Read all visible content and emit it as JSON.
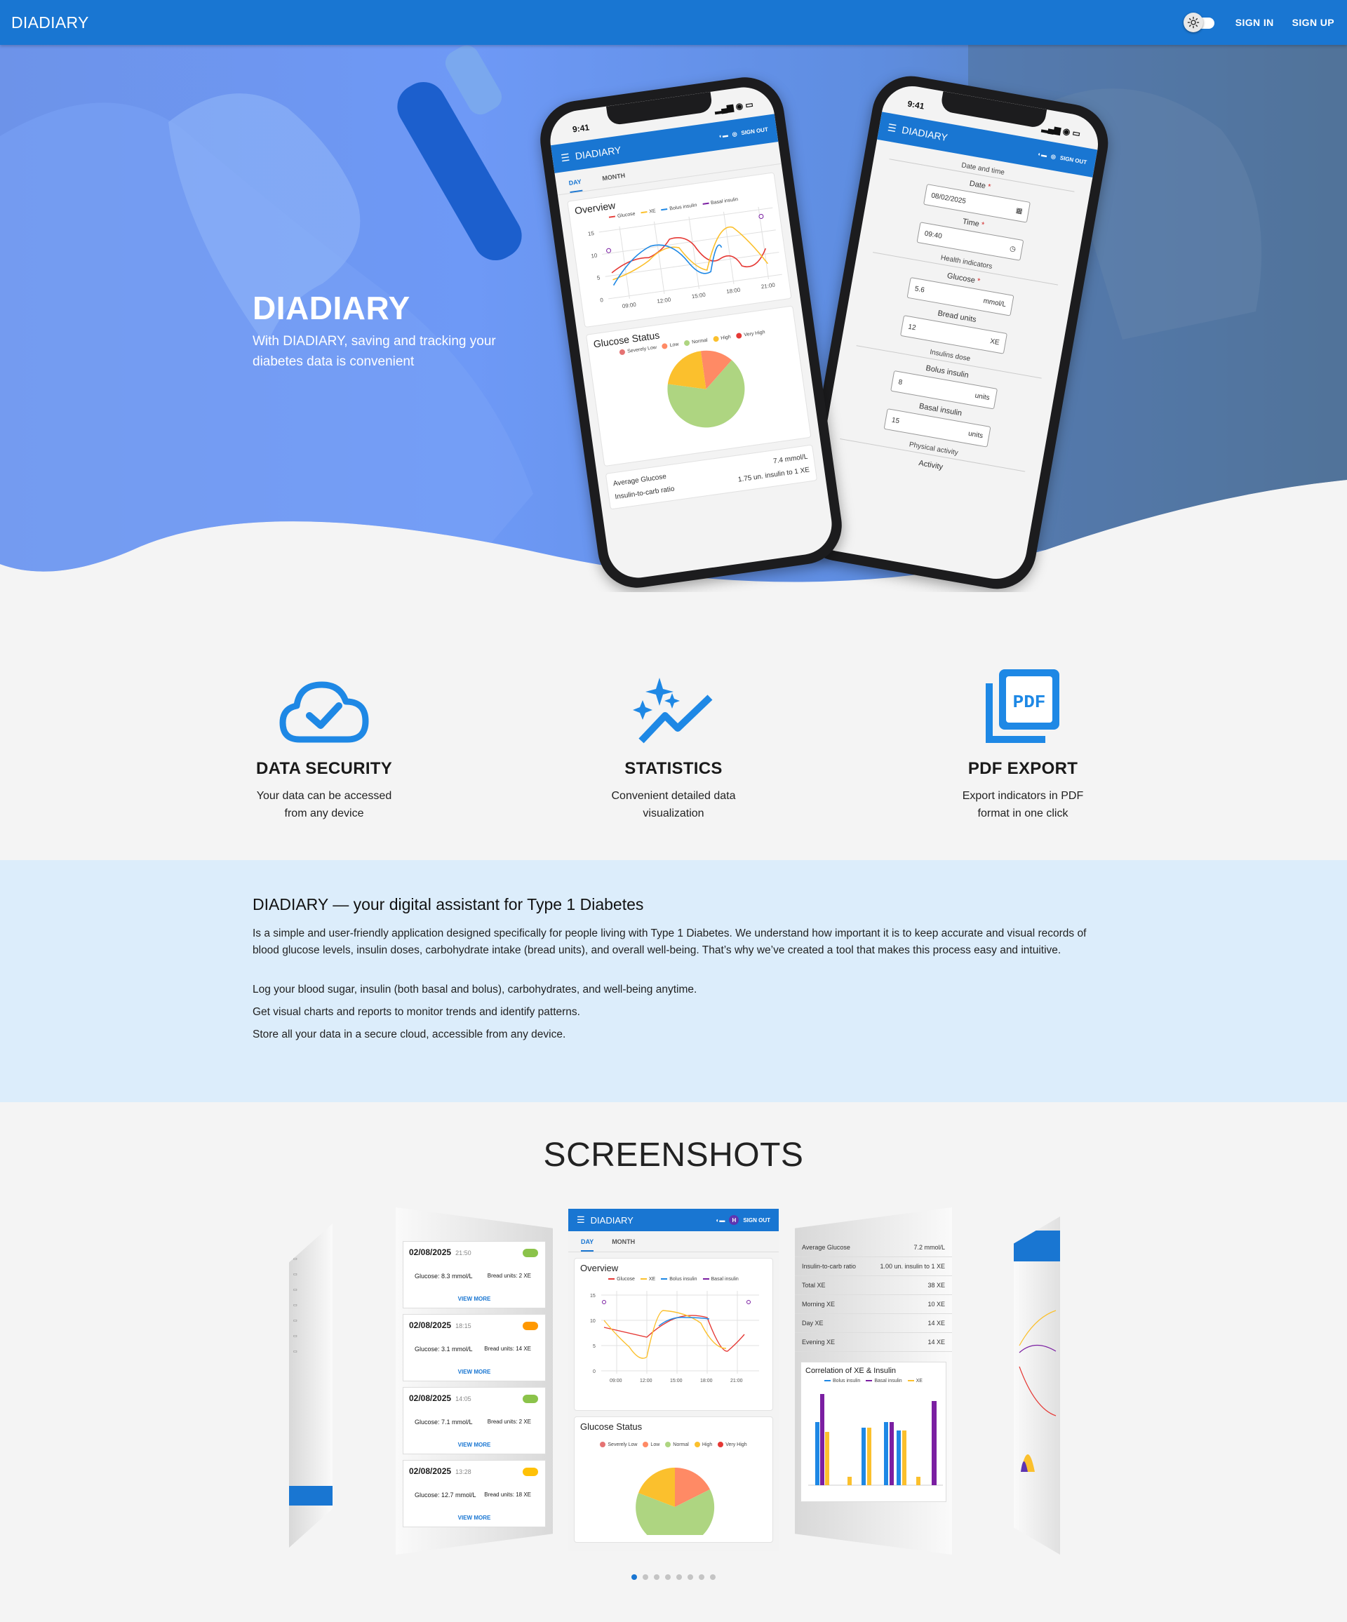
{
  "app": {
    "title": "DIADIARY"
  },
  "nav": {
    "sign_in": "SIGN IN",
    "sign_up": "SIGN UP",
    "theme_toggle_icon": "sun-icon"
  },
  "hero": {
    "title": "DIADIARY",
    "subtitle": "With DIADIARY, saving and tracking your diabetes data is convenient"
  },
  "phone_a": {
    "time": "9:41",
    "app_title": "DIADIARY",
    "sign_out": "SIGN OUT",
    "tabs": [
      "DAY",
      "MONTH"
    ],
    "overview_title": "Overview",
    "legend": [
      "Glucose",
      "XE",
      "Bolus insulin",
      "Basal insulin"
    ],
    "y_ticks": [
      "15",
      "10",
      "5",
      "0"
    ],
    "x_ticks": [
      "09:00",
      "12:00",
      "15:00",
      "18:00",
      "21:00"
    ],
    "status_title": "Glucose Status",
    "status_legend": [
      "Severely Low",
      "Low",
      "Normal",
      "High",
      "Very High"
    ],
    "stats": [
      {
        "label": "Average Glucose",
        "value": "7.4 mmol/L"
      },
      {
        "label": "Insulin-to-carb ratio",
        "value": "1.75 un. insulin to 1 XE"
      }
    ]
  },
  "phone_b": {
    "time": "9:41",
    "app_title": "DIADIARY",
    "sign_out": "SIGN OUT",
    "section_datetime": "Date and time",
    "date_label": "Date",
    "date_value": "08/02/2025",
    "time_label": "Time",
    "time_value": "09:40",
    "section_health": "Health indicators",
    "glucose_label": "Glucose",
    "glucose_value": "5.6",
    "glucose_unit": "mmol/L",
    "bread_label": "Bread units",
    "bread_value": "12",
    "bread_unit": "XE",
    "section_insulin": "Insulins dose",
    "bolus_label": "Bolus insulin",
    "bolus_value": "8",
    "bolus_unit": "units",
    "basal_label": "Basal insulin",
    "basal_value": "15",
    "basal_unit": "units",
    "section_activity": "Physical activity",
    "activity_label": "Activity"
  },
  "features": [
    {
      "title": "DATA SECURITY",
      "text": "Your data can be accessed from any device",
      "icon": "cloud-check-icon"
    },
    {
      "title": "STATISTICS",
      "text": "Convenient detailed data visualization",
      "icon": "sparkle-chart-icon"
    },
    {
      "title": "PDF EXPORT",
      "text": "Export indicators in PDF format in one click",
      "icon": "pdf-icon"
    }
  ],
  "about": {
    "title": "DIADIARY — your digital assistant for Type 1 Diabetes",
    "description": "Is a simple and user-friendly application designed specifically for people living with Type 1 Diabetes. We understand how important it is to keep accurate and visual records of blood glucose levels, insulin doses, carbohydrate intake (bread units), and overall well-being. That’s why we’ve created a tool that makes this process easy and intuitive.",
    "points": [
      "Log your blood sugar, insulin (both basal and bolus), carbohydrates, and well-being anytime.",
      "Get visual charts and reports to monitor trends and identify patterns.",
      "Store all your data in a secure cloud, accessible from any device."
    ]
  },
  "screenshots": {
    "title": "SCREENSHOTS",
    "center": {
      "app_title": "DIADIARY",
      "avatar": "H",
      "sign_out": "SIGN OUT",
      "tabs": [
        "DAY",
        "MONTH"
      ],
      "overview_title": "Overview",
      "legend": [
        "Glucose",
        "XE",
        "Bolus insulin",
        "Basal insulin"
      ],
      "y_ticks": [
        "15",
        "10",
        "5",
        "0"
      ],
      "x_ticks": [
        "09:00",
        "12:00",
        "15:00",
        "18:00",
        "21:00"
      ],
      "status_title": "Glucose Status",
      "status_legend": [
        "Severely Low",
        "Low",
        "Normal",
        "High",
        "Very High"
      ]
    },
    "left": {
      "entries": [
        {
          "date": "02/08/2025",
          "time": "21:50",
          "glucose": "Glucose: 8.3 mmol/L",
          "bread": "Bread units: 2 XE",
          "badge": "#8bc34a"
        },
        {
          "date": "02/08/2025",
          "time": "18:15",
          "glucose": "Glucose: 3.1 mmol/L",
          "bread": "Bread units: 14 XE",
          "badge": "#ff9800"
        },
        {
          "date": "02/08/2025",
          "time": "14:05",
          "glucose": "Glucose: 7.1 mmol/L",
          "bread": "Bread units: 2 XE",
          "badge": "#8bc34a"
        },
        {
          "date": "02/08/2025",
          "time": "13:28",
          "glucose": "Glucose: 12.7 mmol/L",
          "bread": "Bread units: 18 XE",
          "badge": "#ffc107"
        }
      ],
      "view_more": "VIEW MORE"
    },
    "right": {
      "stats": [
        {
          "label": "Average Glucose",
          "value": "7.2 mmol/L"
        },
        {
          "label": "Insulin-to-carb ratio",
          "value": "1.00 un. insulin to 1 XE"
        },
        {
          "label": "Total XE",
          "value": "38 XE"
        },
        {
          "label": "Morning XE",
          "value": "10 XE"
        },
        {
          "label": "Day XE",
          "value": "14 XE"
        },
        {
          "label": "Evening XE",
          "value": "14 XE"
        }
      ],
      "corr_title": "Correlation of XE & Insulin",
      "corr_legend": [
        "Bolus insulin",
        "Basal insulin",
        "XE"
      ]
    },
    "slide_count": 8,
    "active_slide": 0
  },
  "colors": {
    "primary": "#1976d2",
    "hero_overlay": "#5f8ff0",
    "about_bg": "#dcedfb",
    "glucose": "#e53935",
    "xe": "#fbc02d",
    "bolus": "#1e88e5",
    "basal": "#7b1fa2",
    "normal": "#aed581",
    "low": "#ff8a65",
    "high": "#fbc02d"
  }
}
